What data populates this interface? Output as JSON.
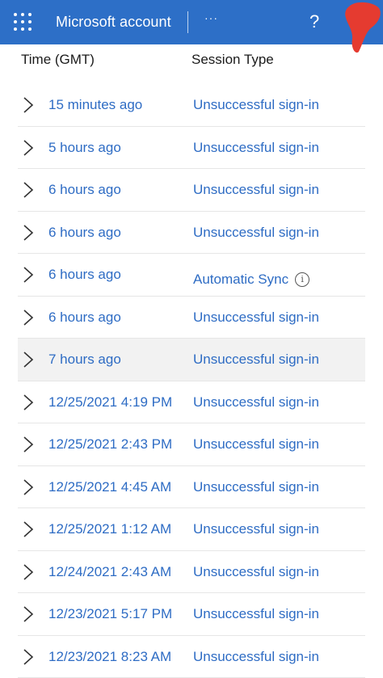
{
  "header": {
    "app_title": "Microsoft account",
    "more_label": "···",
    "help_label": "?",
    "colors": {
      "bar": "#2d6fc7",
      "link": "#2e6cc4",
      "smudge": "#e53b30"
    }
  },
  "table": {
    "col_time": "Time (GMT)",
    "col_type": "Session Type",
    "rows": [
      {
        "time": "15 minutes ago",
        "type": "Unsuccessful sign-in"
      },
      {
        "time": "5 hours ago",
        "type": "Unsuccessful sign-in"
      },
      {
        "time": "6 hours ago",
        "type": "Unsuccessful sign-in"
      },
      {
        "time": "6 hours ago",
        "type": "Unsuccessful sign-in"
      },
      {
        "time": "6 hours ago",
        "type": "Automatic Sync"
      },
      {
        "time": "6 hours ago",
        "type": "Unsuccessful sign-in"
      },
      {
        "time": "7 hours ago",
        "type": "Unsuccessful sign-in"
      },
      {
        "time": "12/25/2021 4:19 PM",
        "type": "Unsuccessful sign-in"
      },
      {
        "time": "12/25/2021 2:43 PM",
        "type": "Unsuccessful sign-in"
      },
      {
        "time": "12/25/2021 4:45 AM",
        "type": "Unsuccessful sign-in"
      },
      {
        "time": "12/25/2021 1:12 AM",
        "type": "Unsuccessful sign-in"
      },
      {
        "time": "12/24/2021 2:43 AM",
        "type": "Unsuccessful sign-in"
      },
      {
        "time": "12/23/2021 5:17 PM",
        "type": "Unsuccessful sign-in"
      },
      {
        "time": "12/23/2021 8:23 AM",
        "type": "Unsuccessful sign-in"
      }
    ]
  }
}
